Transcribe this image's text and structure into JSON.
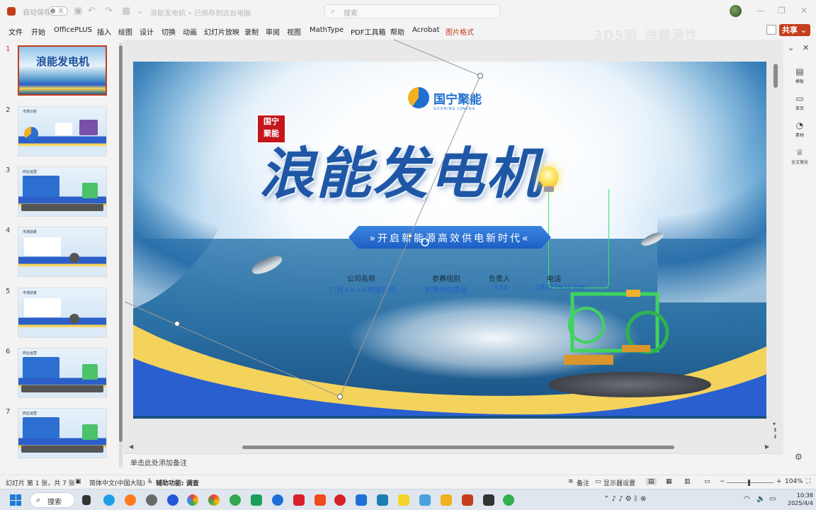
{
  "titlebar": {
    "autosave_label": "自动保存",
    "toggle_state": "关",
    "doc_title": "浪能发电机 • 已保存到这台电脑",
    "search_placeholder": "搜索",
    "window_controls": [
      "minimize-icon",
      "restore-icon",
      "close-icon"
    ]
  },
  "menu": {
    "items": [
      "文件",
      "开始",
      "OfficePLUS",
      "插入",
      "绘图",
      "设计",
      "切换",
      "动画",
      "幻灯片放映",
      "录制",
      "审阅",
      "视图",
      "MathType",
      "PDF工具箱",
      "帮助",
      "Acrobat",
      "图片格式"
    ],
    "active_item": "图片格式",
    "share_label": "共享"
  },
  "watermark": "3D5晒_海螺源性",
  "slides_panel": {
    "numbers": [
      "1",
      "2",
      "3",
      "4",
      "5",
      "6",
      "7"
    ],
    "selected": "1",
    "thumb_titles": [
      "浪能发电机",
      "市场分析",
      "商业运营",
      "市场前景",
      "市场前景",
      "商业运营",
      "商业运营"
    ]
  },
  "slide": {
    "seal_text": "国宁聚能",
    "logo_text": "国宁聚能",
    "logo_sub": "GUONING JUNENG",
    "main_title": "浪能发电机",
    "subtitle": "»开启新能源高效供电新时代«",
    "fields": [
      {
        "label": "公司名称",
        "value": "广西××××有限公司"
      },
      {
        "label": "参赛组别",
        "value": "职教组创意组"
      },
      {
        "label": "负责人",
        "value": "XXX"
      },
      {
        "label": "电话",
        "value": "18077932358"
      }
    ]
  },
  "notes_placeholder": "单击此处添加备注",
  "right_panel": [
    {
      "icon": "template-icon",
      "label": "模板"
    },
    {
      "icon": "page-icon",
      "label": "单页"
    },
    {
      "icon": "material-icon",
      "label": "素材"
    },
    {
      "icon": "beautify-icon",
      "label": "全文美化"
    }
  ],
  "statusbar": {
    "slide_count": "幻灯片 第 1 张，共 7 张",
    "language": "简体中文(中国大陆)",
    "accessibility": "辅助功能: 调查",
    "notes_label": "备注",
    "display_settings": "显示器设置",
    "zoom": "104%"
  },
  "taskbar": {
    "search_label": "搜索",
    "time": "10:38",
    "date": "2025/4/4"
  }
}
